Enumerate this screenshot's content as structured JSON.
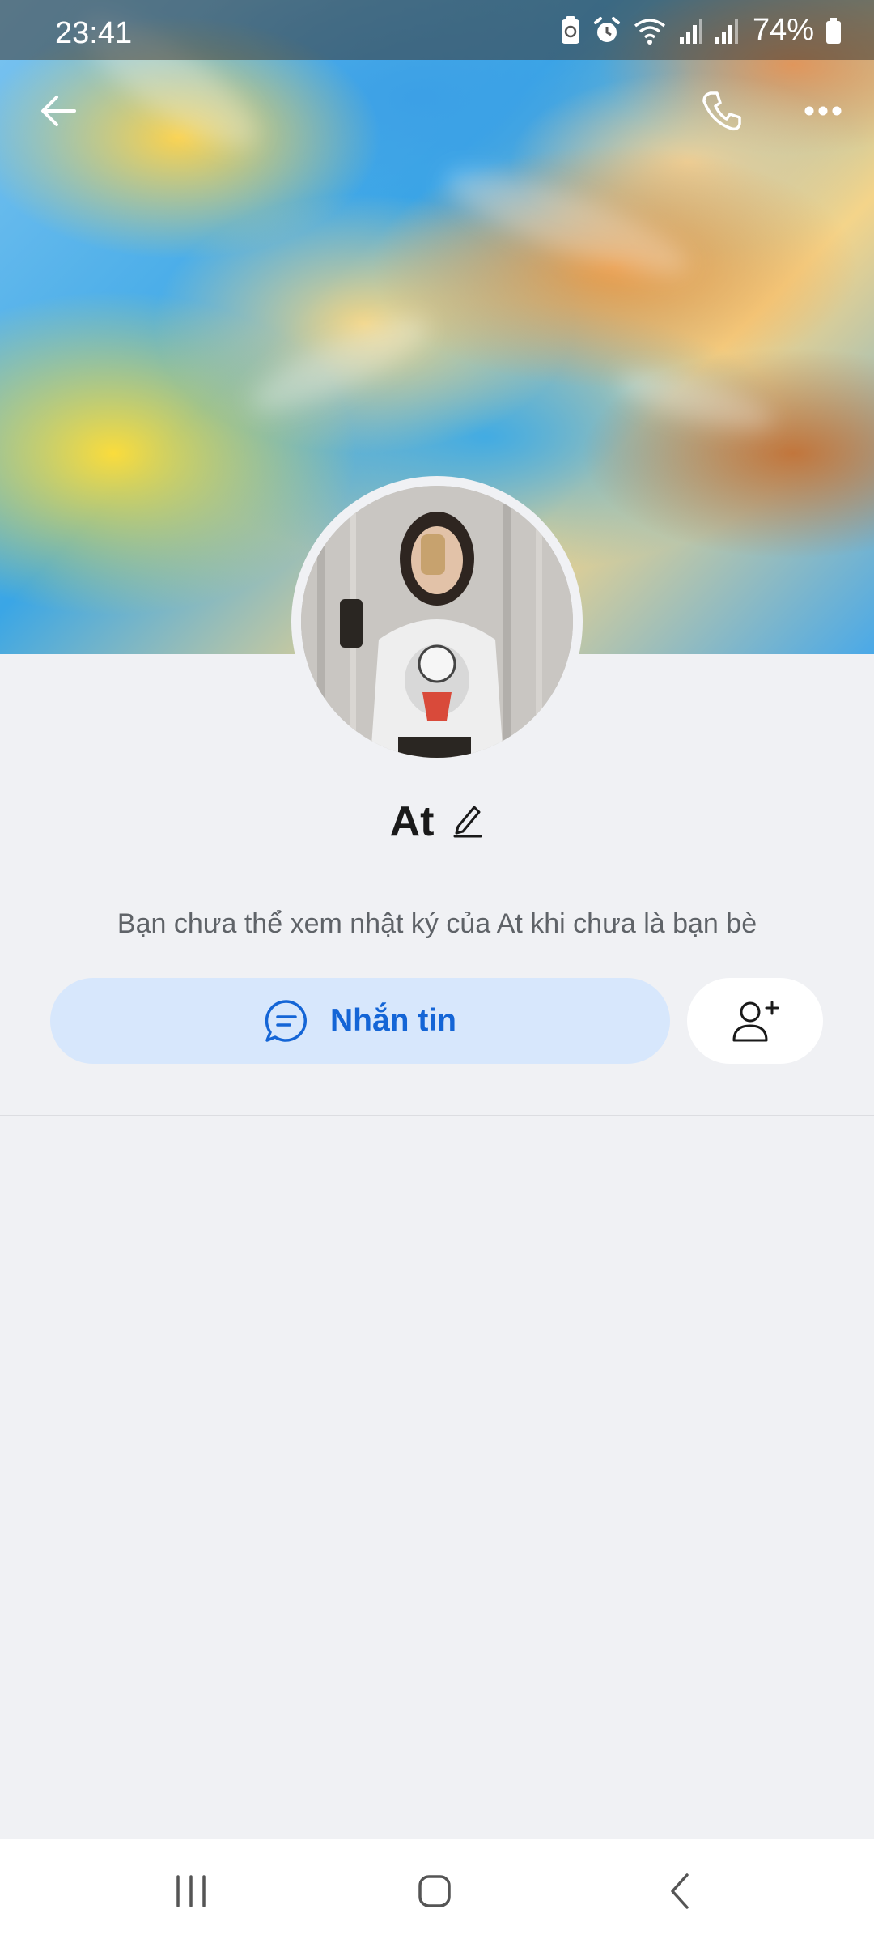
{
  "status_bar": {
    "time": "23:41",
    "battery": "74%",
    "icons": [
      "battery-saver-icon",
      "alarm-icon",
      "wifi-icon",
      "signal-icon",
      "signal-icon",
      "battery-icon"
    ]
  },
  "header": {
    "back_icon": "back-arrow-icon",
    "call_icon": "phone-icon",
    "more_icon": "more-dots-icon"
  },
  "profile": {
    "name": "At",
    "edit_icon": "pencil-icon",
    "notice": "Bạn chưa thể xem nhật ký của At khi chưa là bạn bè"
  },
  "actions": {
    "message_label": "Nhắn tin",
    "message_icon": "chat-bubble-icon",
    "add_friend_icon": "add-friend-icon"
  },
  "colors": {
    "accent": "#1465d6",
    "message_button_bg": "#d7e7fc",
    "page_bg": "#f0f1f4"
  },
  "nav_bar": {
    "icons": [
      "recent-apps-icon",
      "home-icon",
      "back-icon"
    ]
  }
}
